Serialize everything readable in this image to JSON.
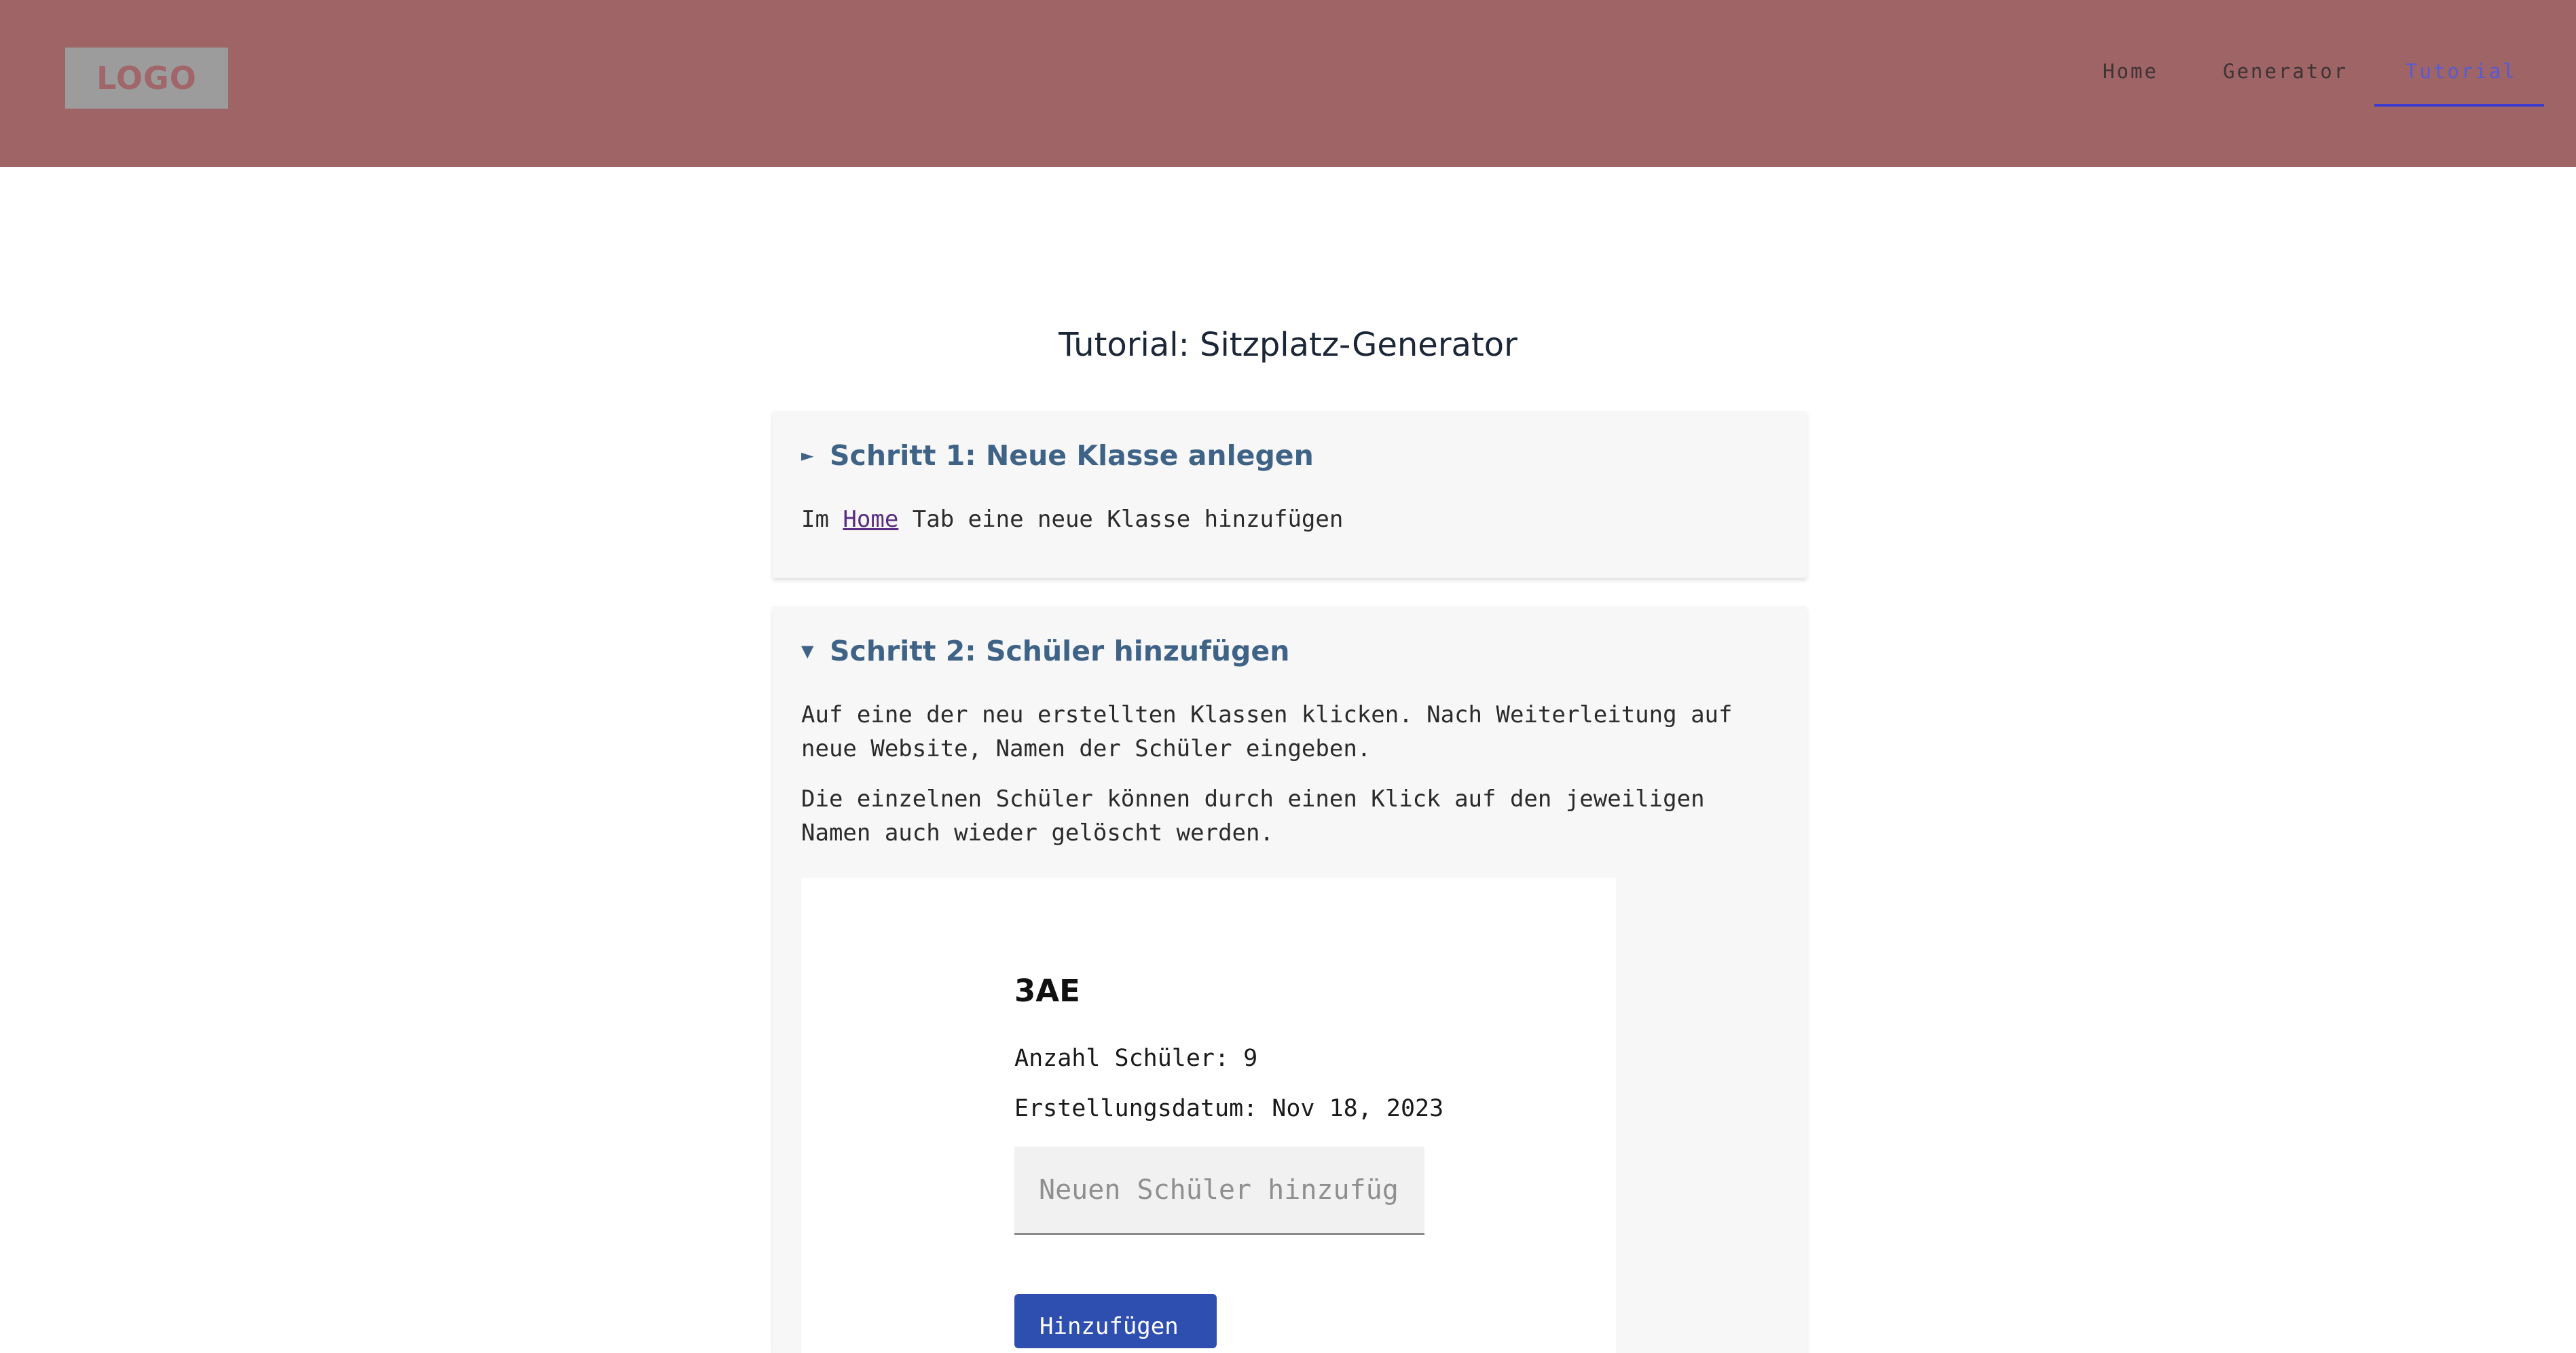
{
  "header": {
    "logo_text": "LOGO",
    "nav": [
      {
        "label": "Home"
      },
      {
        "label": "Generator"
      },
      {
        "label": "Tutorial",
        "active": true
      }
    ],
    "colors": {
      "background": "#9e6466",
      "active_nav": "#3b3ccf"
    }
  },
  "page": {
    "title": "Tutorial: Sitzplatz-Generator"
  },
  "steps": [
    {
      "marker": "►",
      "title": "Schritt 1: Neue Klasse anlegen",
      "expanded": false,
      "text_before_link": "Im ",
      "link_text": "Home",
      "text_after_link": " Tab eine neue Klasse hinzufügen"
    },
    {
      "marker": "▼",
      "title": "Schritt 2: Schüler hinzufügen",
      "expanded": true,
      "paragraphs": [
        "Auf eine der neu erstellten Klassen klicken. Nach Weiterleitung auf neue Website, Namen der Schüler eingeben.",
        "Die einzelnen Schüler können durch einen Klick auf den jeweiligen Namen auch wieder gelöscht werden."
      ],
      "preview": {
        "class_name": "3AE",
        "count_line": "Anzahl Schüler: 9",
        "date_line": "Erstellungsdatum: Nov 18, 2023",
        "input_placeholder": "Neuen Schüler hinzufügen",
        "button_label": "Hinzufügen"
      }
    }
  ]
}
